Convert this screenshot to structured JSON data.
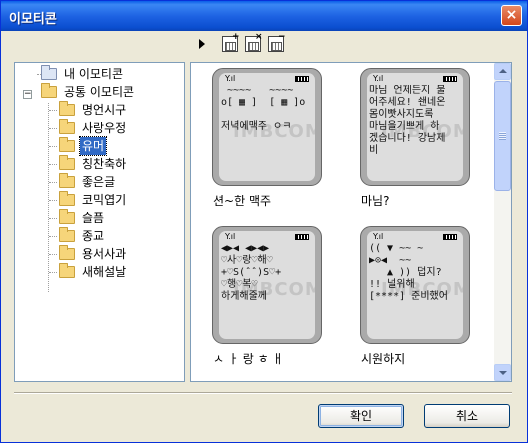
{
  "window": {
    "title": "이모티콘",
    "close_glyph": "×"
  },
  "toolbar": {
    "icons": [
      "play-arrow-icon",
      "add-icon",
      "delete-icon",
      "minimize-icon"
    ]
  },
  "tree": {
    "expander": "−",
    "items": [
      {
        "label": "내 이모티콘"
      },
      {
        "label": "공통 이모티콘"
      },
      {
        "label": "명언시구"
      },
      {
        "label": "사랑우정"
      },
      {
        "label": "유머",
        "selected": true
      },
      {
        "label": "칭찬축하"
      },
      {
        "label": "좋은글"
      },
      {
        "label": "코믹엽기"
      },
      {
        "label": "슬픔"
      },
      {
        "label": "종교"
      },
      {
        "label": "용서사과"
      },
      {
        "label": "새해설날"
      }
    ]
  },
  "emoticons": [
    {
      "antenna": "Y.ıl",
      "screen": " ~~~~   ~~~~\no[ ▦ ]  [ ▦ ]o\n\n저녁에맥주 ㅇㅋ",
      "watermark": "IMBCOM",
      "caption": "션~한 맥주"
    },
    {
      "antenna": "Y.ıl",
      "screen": "마님 언제든지 불\n어주세요! 쇈네온\n몸이빳사지도록\n마님을기쁘게 하\n겠습니다! 강남제\n비",
      "watermark": "IMBCOM",
      "caption": "마님?"
    },
    {
      "antenna": "Y.ıl",
      "screen": "◀▶◀ ◀▶◀▶\n♡사♡랑♡해♡\n+♡S(ˆˆ)S♡+\n♡행♡복♡\n하게해줄께",
      "watermark": "IMBCOM",
      "caption": "ㅅ ㅏ 랑 ㅎ ㅐ"
    },
    {
      "antenna": "Y.ıl",
      "screen": "(( ▼ ~~ ~\n▶⊙◀  ~~\n   ▲ )) 덥지?\n!! 널위해\n[****] 준비했어",
      "watermark": "IMBCOM",
      "caption": "시원하지"
    }
  ],
  "buttons": {
    "ok": "확인",
    "cancel": "취소"
  }
}
